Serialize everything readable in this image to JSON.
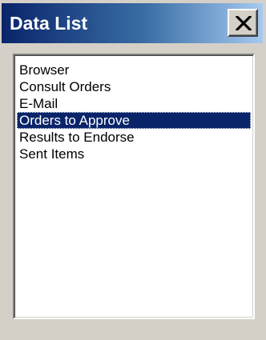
{
  "window": {
    "title": "Data List",
    "close_icon": "close-icon"
  },
  "list": {
    "items": [
      {
        "label": "Browser",
        "selected": false
      },
      {
        "label": "Consult Orders",
        "selected": false
      },
      {
        "label": "E-Mail",
        "selected": false
      },
      {
        "label": "Orders to Approve",
        "selected": true
      },
      {
        "label": "Results to Endorse",
        "selected": false
      },
      {
        "label": "Sent Items",
        "selected": false
      }
    ]
  },
  "colors": {
    "title_start": "#0a246a",
    "title_end": "#a6caf0",
    "selection": "#0a246a",
    "face": "#d4d0c8"
  }
}
